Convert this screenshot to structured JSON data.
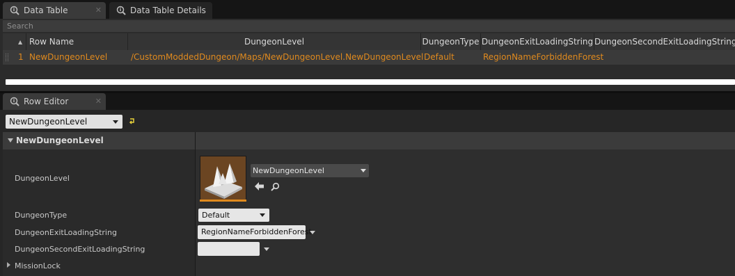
{
  "tabs": [
    {
      "label": "Data Table",
      "active": true,
      "icon": "info-magnifier-icon"
    },
    {
      "label": "Data Table Details",
      "active": false,
      "icon": "info-magnifier-icon"
    }
  ],
  "search": {
    "placeholder": "Search"
  },
  "table": {
    "columns": [
      "Row Name",
      "DungeonLevel",
      "DungeonType",
      "DungeonExitLoadingString",
      "DungeonSecondExitLoadingString"
    ],
    "rows": [
      {
        "index": "1",
        "cells": [
          "NewDungeonLevel",
          "/CustomModdedDungeon/Maps/NewDungeonLevel.NewDungeonLevel",
          "Default",
          "RegionNameForbiddenForest",
          ""
        ]
      }
    ]
  },
  "row_editor": {
    "tab_label": "Row Editor",
    "selected_row": "NewDungeonLevel",
    "category": "NewDungeonLevel",
    "properties": {
      "dungeon_level": {
        "label": "DungeonLevel",
        "asset": "NewDungeonLevel"
      },
      "dungeon_type": {
        "label": "DungeonType",
        "value": "Default"
      },
      "exit_string": {
        "label": "DungeonExitLoadingString",
        "value": "RegionNameForbiddenForest"
      },
      "second_exit_string": {
        "label": "DungeonSecondExitLoadingString",
        "value": ""
      },
      "mission_lock": {
        "label": "MissionLock"
      }
    }
  },
  "colors": {
    "accent": "#e08a1e",
    "background": "#262626",
    "selected_row": "#3a3a3a"
  }
}
